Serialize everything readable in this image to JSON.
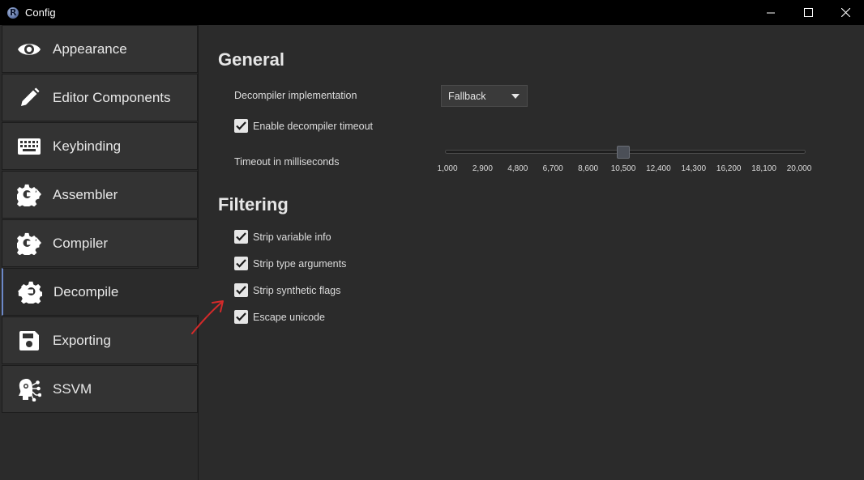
{
  "window": {
    "title": "Config",
    "controls": [
      "minimize-icon",
      "maximize-icon",
      "close-icon"
    ]
  },
  "sidebar": {
    "items": [
      {
        "label": "Appearance",
        "icon": "eye-icon",
        "active": false
      },
      {
        "label": "Editor Components",
        "icon": "pencil-icon",
        "active": false
      },
      {
        "label": "Keybinding",
        "icon": "keyboard-icon",
        "active": false
      },
      {
        "label": "Assembler",
        "icon": "gear-arrow-out-icon",
        "active": false
      },
      {
        "label": "Compiler",
        "icon": "gear-arrow-out-icon",
        "active": false
      },
      {
        "label": "Decompile",
        "icon": "gear-arrow-in-icon",
        "active": true
      },
      {
        "label": "Exporting",
        "icon": "floppy-disk-icon",
        "active": false
      },
      {
        "label": "SSVM",
        "icon": "brain-circuit-icon",
        "active": false
      }
    ]
  },
  "general": {
    "title": "General",
    "decompiler_label": "Decompiler implementation",
    "decompiler_value": "Fallback",
    "timeout_checkbox_label": "Enable decompiler timeout",
    "timeout_checked": true,
    "timeout_ms_label": "Timeout in milliseconds",
    "slider": {
      "min": 1000,
      "max": 20000,
      "value": 10500,
      "ticks": [
        "1,000",
        "2,900",
        "4,800",
        "6,700",
        "8,600",
        "10,500",
        "12,400",
        "14,300",
        "16,200",
        "18,100",
        "20,000"
      ]
    }
  },
  "filtering": {
    "title": "Filtering",
    "options": [
      {
        "label": "Strip variable info",
        "checked": true
      },
      {
        "label": "Strip type arguments",
        "checked": true
      },
      {
        "label": "Strip synthetic flags",
        "checked": true
      },
      {
        "label": "Escape unicode",
        "checked": true
      }
    ]
  },
  "colors": {
    "background": "#2b2b2b",
    "titlebar": "#000000",
    "sidebar_item": "#333333",
    "active_accent": "#6c88c8",
    "annotation": "#d42a2a"
  }
}
